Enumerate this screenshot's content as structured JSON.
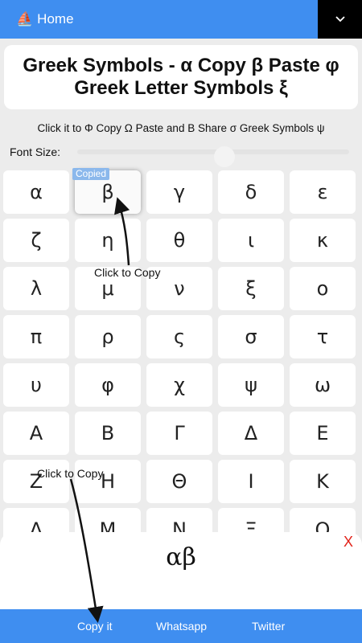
{
  "nav": {
    "home_label": "Home",
    "home_icon": "sailboat-icon",
    "menu_icon": "chevron-down-icon"
  },
  "title": "Greek Symbols - α Copy β Paste φ Greek Letter Symbols ξ",
  "subtitle": "Click it to Φ Copy Ω Paste and Β Share σ Greek Symbols ψ",
  "font_size_label": "Font Size:",
  "copied_label": "Copied",
  "hints": [
    "Click to Copy",
    "Click to Copy"
  ],
  "symbols": [
    "α",
    "β",
    "γ",
    "δ",
    "ε",
    "ζ",
    "η",
    "θ",
    "ι",
    "κ",
    "λ",
    "μ",
    "ν",
    "ξ",
    "ο",
    "π",
    "ρ",
    "ς",
    "σ",
    "τ",
    "υ",
    "φ",
    "χ",
    "ψ",
    "ω",
    "Α",
    "Β",
    "Γ",
    "Δ",
    "Ε",
    "Ζ",
    "Η",
    "Θ",
    "Ι",
    "Κ",
    "Λ",
    "Μ",
    "Ν",
    "Ξ",
    "Ο"
  ],
  "selected_index": 1,
  "output": {
    "text": "αβ",
    "close_label": "X"
  },
  "actions": {
    "copy": "Copy it",
    "whatsapp": "Whatsapp",
    "twitter": "Twitter"
  },
  "colors": {
    "accent": "#3f8ef0",
    "close": "#e2231a",
    "badge": "#8bb8ec"
  }
}
